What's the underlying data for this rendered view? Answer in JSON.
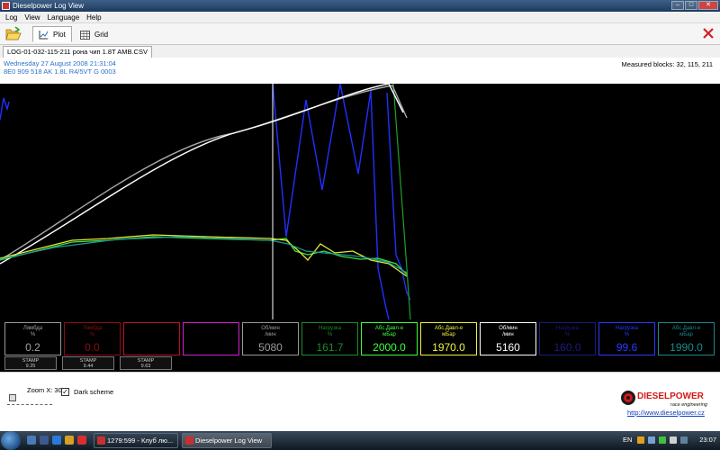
{
  "window": {
    "title": "Dieselpower Log View",
    "min_label": "–",
    "max_label": "□",
    "close_label": "✕"
  },
  "menu": [
    "Log",
    "View",
    "Language",
    "Help"
  ],
  "toolbar": {
    "open_icon": "folder-open-icon",
    "plot_label": "Plot",
    "grid_label": "Grid",
    "close_icon": "red-x-icon"
  },
  "file_tab": {
    "name": "LOG-01-032-115-211 рона чип 1.8T AMB.CSV"
  },
  "info": {
    "date": "Wednesday 27 August 2008 21:31:04",
    "ecu": "8E0 909 518 AK  1.8L R4/5VT     G  0003",
    "measured_blocks": "Measured blocks: 32, 115, 211"
  },
  "cursor_position": 0.38,
  "channels": [
    {
      "name": "Лямбда\n%",
      "value": "0.2",
      "color": "#a0a0a0",
      "border": "#9a9a9a"
    },
    {
      "name": "Лямбда\n%",
      "value": "0.0",
      "color": "#8a1010",
      "border": "#8a1010"
    },
    {
      "name": "",
      "value": "",
      "color": "#c01030",
      "border": "#c01030"
    },
    {
      "name": "",
      "value": "",
      "color": "#d020d0",
      "border": "#d020d0"
    },
    {
      "name": "Об/мин\n/мин",
      "value": "5080",
      "color": "#9a9a9a",
      "border": "#9a9a9a"
    },
    {
      "name": "Нагрузка\n%",
      "value": "161.7",
      "color": "#1f8a2a",
      "border": "#1f8a2a"
    },
    {
      "name": "Абс.Давл-е\nмБар",
      "value": "2000.0",
      "color": "#40ff40",
      "border": "#40ff40"
    },
    {
      "name": "Абс.Давл-е\nмБар",
      "value": "1970.0",
      "color": "#f0f040",
      "border": "#f0f040"
    },
    {
      "name": "Об/мин\n/мин",
      "value": "5160",
      "color": "#ffffff",
      "border": "#ffffff"
    },
    {
      "name": "Нагрузка\n%",
      "value": "160.0",
      "color": "#1a1a80",
      "border": "#1a1a80"
    },
    {
      "name": "Нагрузка\n%",
      "value": "99.6",
      "color": "#2a3aff",
      "border": "#2a3aff"
    },
    {
      "name": "Абс.Давл-е\nмБар",
      "value": "1990.0",
      "color": "#1a8a8a",
      "border": "#1a8a8a"
    }
  ],
  "stamps": [
    {
      "label": "STAMP",
      "value": "9.25"
    },
    {
      "label": "STAMP",
      "value": "9.44"
    },
    {
      "label": "STAMP",
      "value": "9.63"
    }
  ],
  "bottom": {
    "zoom": "Zoom X: 30",
    "dark_scheme_label": "Dark scheme",
    "dark_scheme_checked": "✓",
    "logo_main": "DIESELPOWER",
    "logo_sub": "race engineering",
    "link": "http://www.dieselpower.cz"
  },
  "taskbar": {
    "tasks": [
      {
        "label": "1279:599 - Клуб лю...",
        "icon_color": "#c83030"
      },
      {
        "label": "Dieselpower Log View",
        "icon_color": "#c83030"
      }
    ],
    "lang": "EN",
    "clock": "23:07"
  },
  "colors": {
    "rpm_white": "#ffffff",
    "rpm_gray": "#a8a8a8",
    "boost_green": "#40e040",
    "boost_yellow": "#e8e830",
    "load_blue": "#2030ff",
    "load_green": "#1fa02a",
    "teal": "#1a9a9a"
  }
}
